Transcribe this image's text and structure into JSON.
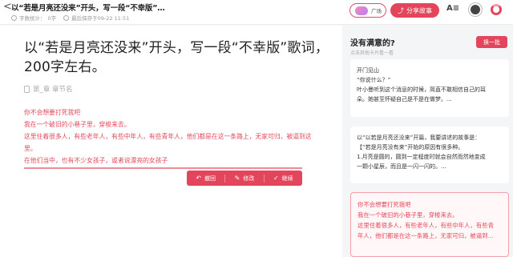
{
  "header": {
    "back_glyph": "<",
    "title": "以“若是月亮还没来”开头，写一段“不幸版”…",
    "word_count_label": "字数统计：",
    "word_count": "0字",
    "last_saved": "最后保存于09-22 11:51",
    "guang_label": "广场",
    "share_label": "分享故事",
    "font_icon_text": "A≡"
  },
  "editor": {
    "title": "以“若是月亮还没来”开头，写一段“不幸版”歌词，200字左右。",
    "chapter_placeholder": "第_章 章节名",
    "generated_lines": [
      "你不会想要打死我吧",
      "我在一个破旧的小巷子里，穿梭来去。",
      "这里住着很多人，有些老年人，有些中年人，有些青年人，他们都是在这一条路上，无家可归，被逼到这里。",
      "在他们当中，也有不少女孩子，或者说漂亮的女孩子"
    ],
    "actions": {
      "undo_label": "撤回",
      "edit_label": "修改",
      "continue_label": "继续"
    }
  },
  "panel": {
    "heading": "没有满意的?",
    "subheading": "点击其他卡片看一看",
    "refresh_label": "换一批",
    "card1_lines": [
      "开门见山",
      "“你说什么？”",
      "叶小曼听到这个消息的时候，简直不敢相信自己的耳",
      "朵。她甚至怀疑自己是不是在做梦。..."
    ],
    "card2_lines": [
      "以“以若是月亮还没来”开篇，我要讲述的故事是：",
      "【“若是月亮没有来”开始的原因有很多种。",
      "1.月亮是圆的，圆到一定程度时就会自然而然地变成",
      "一颗小星辰，而且是一闪一闪的。..."
    ],
    "card3_lines": [
      "你不会想要打死我吧",
      "我在一个破旧的小巷子里，穿梭来去。",
      "这里住着很多人，有些老年人，有些中年人，有些青",
      "年人，他们都是在这一条路上，无家可归，被逼到..."
    ]
  },
  "colors": {
    "accent": "#e3465c",
    "generated_text": "#e0495b"
  }
}
